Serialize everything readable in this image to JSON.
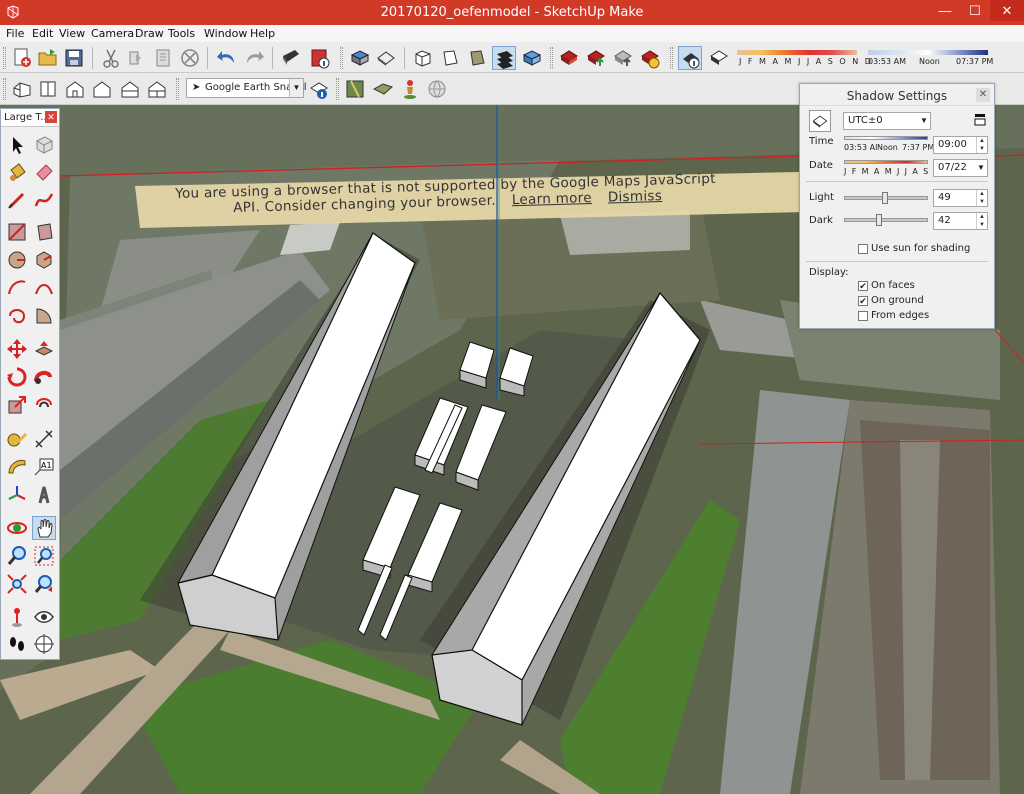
{
  "window": {
    "title": "20170120_oefenmodel - SketchUp Make",
    "minimize": "—",
    "maximize": "☐",
    "close": "✕",
    "accent": "#d23a28"
  },
  "menu": [
    "File",
    "Edit",
    "View",
    "Camera",
    "Draw",
    "Tools",
    "Window",
    "Help"
  ],
  "toolbar": {
    "months_label": "J F M A M J J A S O N D",
    "time_start": "03:53 AM",
    "time_noon": "Noon",
    "time_end": "07:37 PM",
    "scene_select": "Google Earth Snapsl",
    "icons_row1": [
      "new-icon",
      "open-icon",
      "save-icon",
      "cut-icon",
      "copy-icon",
      "paste-icon",
      "erase-icon",
      "undo-icon",
      "redo-icon",
      "print-icon",
      "model-info-icon",
      "iso-icon",
      "top-icon",
      "front-icon",
      "right-icon",
      "back-icon",
      "left-icon",
      "warehouse-get-icon",
      "warehouse-share-icon",
      "share-component-icon",
      "extension-icon",
      "shadows-icon",
      "fog-icon"
    ],
    "icons_row2": [
      "iso-house-icon",
      "top-house-icon",
      "front-house-icon",
      "right-house-icon",
      "back-house-icon",
      "add-location-icon",
      "toggle-terrain-icon",
      "photo-texture-icon",
      "street-view-icon",
      "earth-icon"
    ]
  },
  "toolset": {
    "title": "Large T...",
    "close": "✕",
    "tools": [
      "select-icon",
      "component-icon",
      "paint-bucket-icon",
      "eraser-icon",
      "line-icon",
      "freehand-icon",
      "rectangle-icon",
      "rotated-rectangle-icon",
      "circle-icon",
      "polygon-icon",
      "arc-icon",
      "two-point-arc-icon",
      "three-point-arc-icon",
      "pie-icon",
      "move-icon",
      "push-pull-icon",
      "rotate-icon",
      "follow-me-icon",
      "scale-icon",
      "offset-icon",
      "tape-measure-icon",
      "dimension-icon",
      "protractor-icon",
      "text-icon",
      "axes-icon",
      "3d-text-icon",
      "orbit-icon",
      "pan-icon",
      "zoom-icon",
      "zoom-window-icon",
      "zoom-extents-icon",
      "previous-view-icon",
      "position-camera-icon",
      "look-around-icon",
      "walk-icon",
      "section-plane-icon"
    ]
  },
  "banner": {
    "line1": "You are using a browser that is not supported by the Google Maps JavaScript",
    "line2": "API. Consider changing your browser.",
    "learn_more": "Learn more",
    "dismiss": "Dismiss"
  },
  "shadow": {
    "title": "Shadow Settings",
    "close": "✕",
    "timezone": "UTC±0",
    "time_label": "Time",
    "time_start": "03:53 Al",
    "time_noon": "Noon",
    "time_end": "7:37 PM",
    "time_value": "09:00",
    "date_label": "Date",
    "date_months": "J F M A M J J A S O N D",
    "date_value": "07/22",
    "light_label": "Light",
    "light_value": "49",
    "light_level": 0.49,
    "dark_label": "Dark",
    "dark_value": "42",
    "dark_level": 0.42,
    "use_sun_label": "Use sun for shading",
    "use_sun_checked": false,
    "display_label": "Display:",
    "on_faces_label": "On faces",
    "on_faces_checked": true,
    "on_ground_label": "On ground",
    "on_ground_checked": true,
    "from_edges_label": "From edges",
    "from_edges_checked": false
  }
}
